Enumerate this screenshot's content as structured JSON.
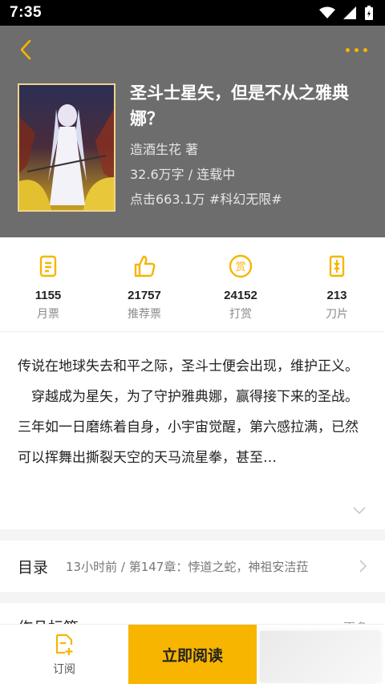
{
  "status_bar": {
    "time": "7:35"
  },
  "header": {
    "back_icon": "chevron-left-icon",
    "more_icon": "more-dots-icon"
  },
  "book": {
    "title": "圣斗士星矢，但是不从之雅典娜？",
    "author": "造酒生花  著",
    "meta": "32.6万字 / 连载中",
    "stats": "点击663.1万  #科幻无限#"
  },
  "stats": [
    {
      "icon": "monthly-ticket-icon",
      "value": "1155",
      "label": "月票"
    },
    {
      "icon": "thumbs-up-icon",
      "value": "21757",
      "label": "推荐票"
    },
    {
      "icon": "reward-icon",
      "value": "24152",
      "label": "打赏"
    },
    {
      "icon": "blade-icon",
      "value": "213",
      "label": "刀片"
    }
  ],
  "description": {
    "paragraph1": "传说在地球失去和平之际，圣斗士便会出现，维护正义。",
    "paragraph2": "　穿越成为星矢，为了守护雅典娜，赢得接下来的圣战。三年如一日磨练着自身，小宇宙觉醒，第六感拉满，已然可以挥舞出撕裂天空的天马流星拳，甚至…"
  },
  "catalog": {
    "title": "目录",
    "latest": "13小时前 / 第147章：悖道之蛇，神祖安洁菈"
  },
  "tags": {
    "title": "作品标签",
    "more": "更多"
  },
  "bottom_bar": {
    "subscribe_label": "订阅",
    "read_label": "立即阅读"
  },
  "colors": {
    "accent": "#f7b500",
    "header_bg": "#6d6d6d"
  }
}
